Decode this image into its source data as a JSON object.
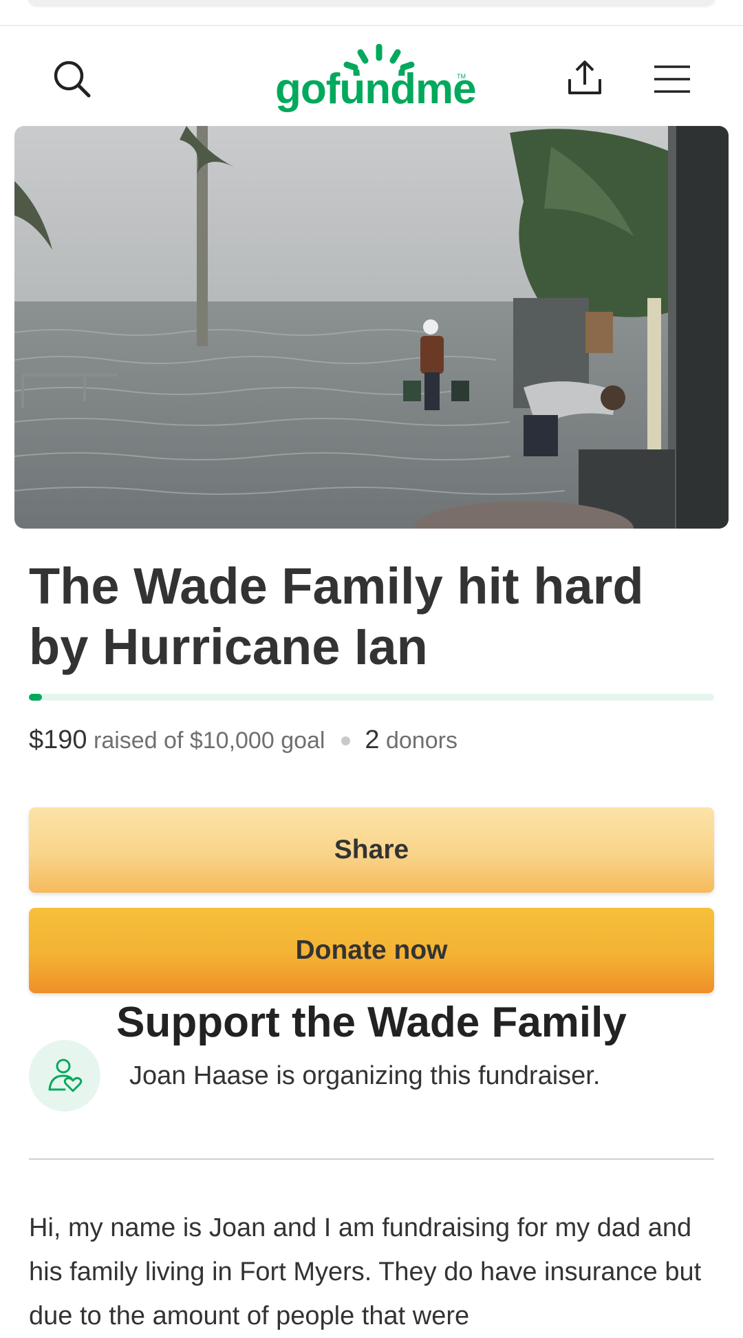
{
  "header": {
    "logo_text": "gofundme",
    "logo_tm": "TM",
    "icons": [
      "search-icon",
      "share-icon",
      "menu-icon"
    ],
    "brand_color": "#02a95c"
  },
  "campaign": {
    "title": "The Wade Family hit hard by Hurricane Ian",
    "progress_fraction": 0.019,
    "raised": "$190",
    "raised_of_goal": "raised of $10,000 goal",
    "donor_count": "2",
    "donors_label": "donors"
  },
  "actions": {
    "share_label": "Share",
    "donate_label": "Donate now"
  },
  "support": {
    "heading": "Support the Wade Family",
    "organizer_text": "Joan Haase is organizing this fundraiser."
  },
  "story": {
    "text": "Hi, my name is Joan and I am fundraising for my dad and his family living in Fort Myers. They do have insurance but due to the amount of people that were"
  }
}
